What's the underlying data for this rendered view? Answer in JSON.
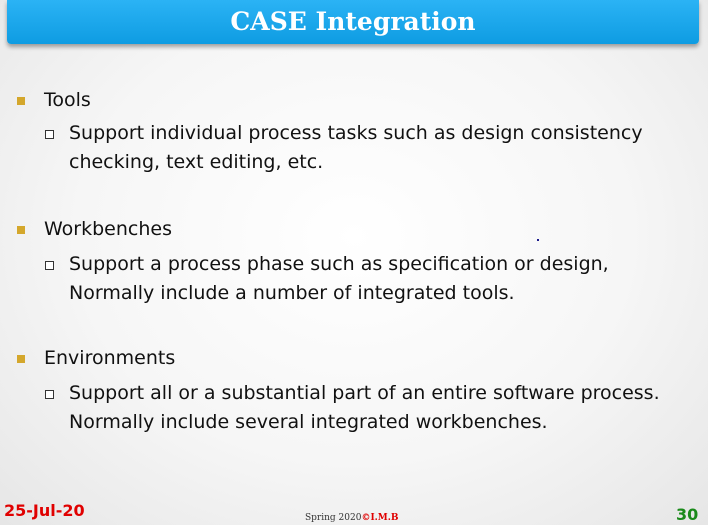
{
  "slide": {
    "title": "CASE Integration",
    "items": [
      {
        "heading": "Tools",
        "sub_line1": "Support individual process tasks such as design consistency",
        "sub_line2": "checking, text editing, etc."
      },
      {
        "heading": "Workbenches",
        "sub_line1": "Support a process phase such as specification or design,",
        "sub_line2": "Normally include a number of integrated tools."
      },
      {
        "heading": "Environments",
        "sub_line1": "Support all or a substantial part of an entire software process.",
        "sub_line2": "Normally include several integrated workbenches."
      }
    ]
  },
  "footer": {
    "date": "25-Jul-20",
    "center_text": "Spring 2020",
    "center_author": "©I.M.B",
    "page_number": "30"
  },
  "colors": {
    "title_bar": "#0e9ce2",
    "bullet_level1": "#d4a72c",
    "footer_date": "#e00000",
    "footer_page": "#1a8a1a"
  }
}
